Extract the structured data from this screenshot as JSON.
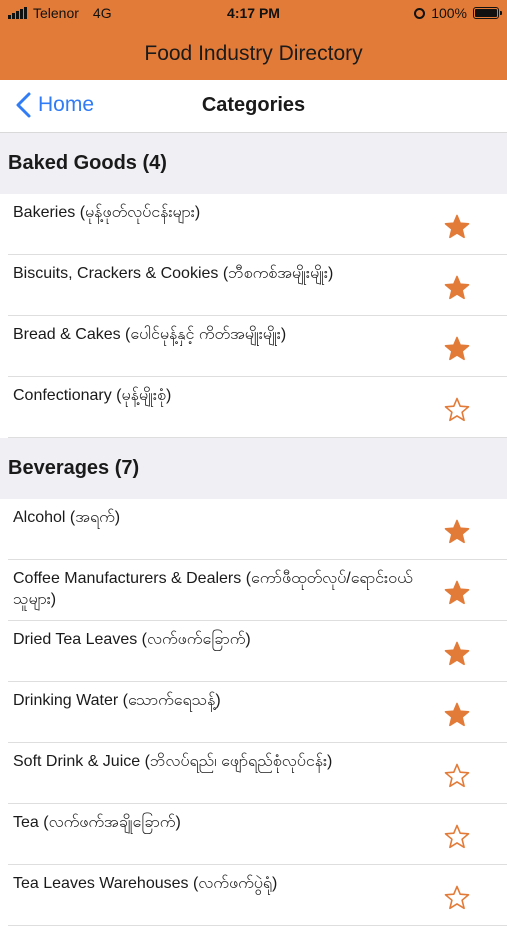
{
  "status_bar": {
    "carrier": "Telenor",
    "network": "4G",
    "time": "4:17 PM",
    "battery": "100%"
  },
  "app": {
    "title": "Food Industry Directory",
    "accent_color": "#e37b38"
  },
  "nav": {
    "back_label": "Home",
    "title": "Categories"
  },
  "sections": [
    {
      "title": "Baked Goods (4)",
      "items": [
        {
          "label": "Bakeries (မုန့်ဖုတ်လုပ်ငန်းများ)",
          "favorite": true
        },
        {
          "label": "Biscuits, Crackers & Cookies (ဘီစကစ်အမျိုးမျိုး)",
          "favorite": true
        },
        {
          "label": "Bread & Cakes (ပေါင်မုန့်နှင့် ကိတ်အမျိုးမျိုး)",
          "favorite": true
        },
        {
          "label": "Confectionary (မုန့်မျိုးစုံ)",
          "favorite": false
        }
      ]
    },
    {
      "title": "Beverages (7)",
      "items": [
        {
          "label": "Alcohol (အရက်)",
          "favorite": true
        },
        {
          "label": "Coffee Manufacturers & Dealers (ကော်ဖီထုတ်လုပ်/ရောင်းဝယ်သူများ)",
          "favorite": true
        },
        {
          "label": "Dried Tea Leaves (လက်ဖက်ခြောက်)",
          "favorite": true
        },
        {
          "label": "Drinking Water (သောက်ရေသန့်)",
          "favorite": true
        },
        {
          "label": "Soft Drink & Juice (ဘိလပ်ရည်၊ ဖျော်ရည်စုံလုပ်ငန်း)",
          "favorite": false
        },
        {
          "label": "Tea (လက်ဖက်အချိုခြောက်)",
          "favorite": false
        },
        {
          "label": "Tea Leaves Warehouses (လက်ဖက်ပွဲရုံ)",
          "favorite": false
        }
      ]
    }
  ]
}
